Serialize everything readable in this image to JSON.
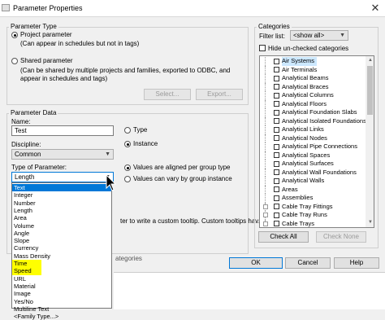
{
  "window": {
    "title": "Parameter Properties",
    "close": "✕"
  },
  "parameter_type": {
    "group_label": "Parameter Type",
    "project_label": "Project parameter",
    "project_desc": "(Can appear in schedules but not in tags)",
    "shared_label": "Shared parameter",
    "shared_desc_1": "(Can be shared by multiple projects and families, exported to ODBC, and",
    "shared_desc_2": "appear in schedules and tags)",
    "select_button": "Select...",
    "export_button": "Export...",
    "selected": "Project parameter"
  },
  "parameter_data": {
    "group_label": "Parameter Data",
    "name_label": "Name:",
    "name_value": "Test",
    "type_radio": "Type",
    "instance_radio": "Instance",
    "instance_selected": true,
    "discipline_label": "Discipline:",
    "discipline_value": "Common",
    "type_of_param_label": "Type of Parameter:",
    "type_of_param_value": "Length",
    "aligned_radio": "Values are aligned per group type",
    "vary_radio": "Values can vary by group instance",
    "aligned_selected": true,
    "tooltip_text": "ter to write a custom tooltip. Custom tooltips hav...",
    "categories_fragment": "ategories"
  },
  "dropdown": {
    "items": [
      "Text",
      "Integer",
      "Number",
      "Length",
      "Area",
      "Volume",
      "Angle",
      "Slope",
      "Currency",
      "Mass Density",
      "Time",
      "Speed",
      "URL",
      "Material",
      "Image",
      "Yes/No",
      "Multiline Text",
      "<Family Type...>"
    ],
    "selected": "Text",
    "highlighted": [
      "Time",
      "Speed"
    ]
  },
  "categories": {
    "group_label": "Categories",
    "filter_label": "Filter list:",
    "filter_value": "<show all>",
    "hide_unchecked": "Hide un-checked categories",
    "items": [
      "Air Systems",
      "Air Terminals",
      "Analytical Beams",
      "Analytical Braces",
      "Analytical Columns",
      "Analytical Floors",
      "Analytical Foundation Slabs",
      "Analytical Isolated Foundations",
      "Analytical Links",
      "Analytical Nodes",
      "Analytical Pipe Connections",
      "Analytical Spaces",
      "Analytical Surfaces",
      "Analytical Wall Foundations",
      "Analytical Walls",
      "Areas",
      "Assemblies",
      "Cable Tray Fittings",
      "Cable Tray Runs",
      "Cable Trays"
    ],
    "selected": "Air Systems",
    "check_all": "Check All",
    "check_none": "Check None"
  },
  "footer": {
    "ok": "OK",
    "cancel": "Cancel",
    "help": "Help"
  },
  "colors": {
    "accent": "#0078d7",
    "highlight": "#ffff00",
    "selection": "#cce8ff"
  }
}
